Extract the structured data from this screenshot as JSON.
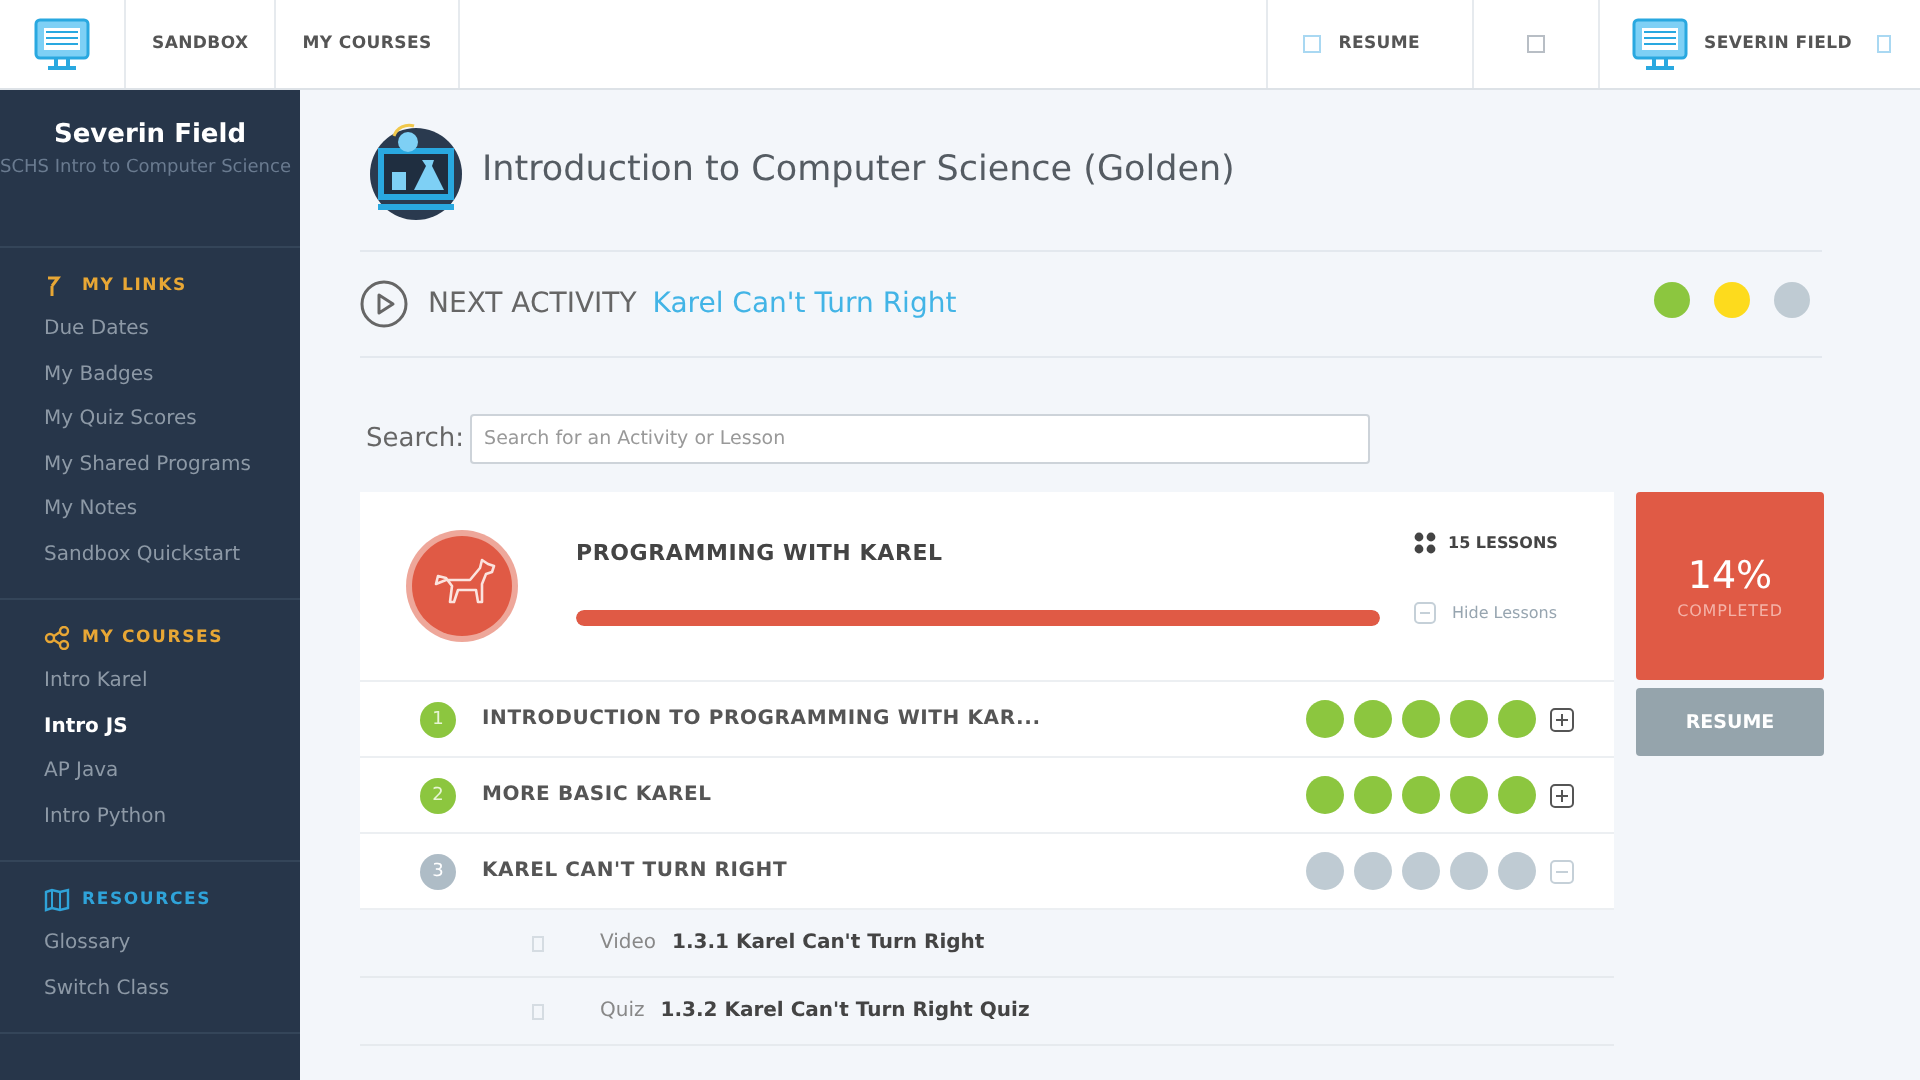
{
  "topbar": {
    "nav": [
      {
        "label": "SANDBOX",
        "selected": false
      },
      {
        "label": "MY COURSES",
        "selected": false
      }
    ],
    "resume": "RESUME",
    "user": "SEVERIN FIELD"
  },
  "sidebar": {
    "user_name": "Severin Field",
    "class_name": "SCHS Intro to Computer Science",
    "sections": [
      {
        "kind": "links",
        "title": "MY LINKS",
        "items": [
          {
            "label": "Due Dates",
            "selected": false
          },
          {
            "label": "My Badges",
            "selected": false
          },
          {
            "label": "My Quiz Scores",
            "selected": false
          },
          {
            "label": "My Shared Programs",
            "selected": false
          },
          {
            "label": "My Notes",
            "selected": false
          },
          {
            "label": "Sandbox Quickstart",
            "selected": false
          }
        ]
      },
      {
        "kind": "courses",
        "title": "MY COURSES",
        "items": [
          {
            "label": "Intro Karel",
            "selected": false
          },
          {
            "label": "Intro JS",
            "selected": true
          },
          {
            "label": "AP Java",
            "selected": false
          },
          {
            "label": "Intro Python",
            "selected": false
          }
        ]
      },
      {
        "kind": "resources",
        "title": "RESOURCES",
        "items": [
          {
            "label": "Glossary",
            "selected": false
          },
          {
            "label": "Switch Class",
            "selected": false
          }
        ]
      }
    ]
  },
  "course": {
    "title": "Introduction to Computer Science (Golden)"
  },
  "next_activity": {
    "label": "NEXT ACTIVITY",
    "link": "Karel Can't Turn Right"
  },
  "legend": [
    {
      "color": "#8cc63f"
    },
    {
      "color": "#fddb1d"
    },
    {
      "color": "#bfcbd3"
    }
  ],
  "search": {
    "label": "Search:",
    "placeholder": "Search for an Activity or Lesson"
  },
  "unit": {
    "title": "PROGRAMMING WITH KAREL",
    "lessons_count": "15 LESSONS",
    "hide_label": "Hide Lessons",
    "level": 1.0,
    "percent": "14%",
    "completed_label": "COMPLETED",
    "resume": "RESUME",
    "lessons": [
      {
        "number": "1",
        "title": "INTRODUCTION TO PROGRAMMING WITH KAR...",
        "completed": true,
        "expanded": false,
        "activities": [
          {
            "done": true
          },
          {
            "done": true
          },
          {
            "done": true
          },
          {
            "done": true
          },
          {
            "done": true
          }
        ]
      },
      {
        "number": "2",
        "title": "MORE BASIC KAREL",
        "completed": true,
        "expanded": false,
        "activities": [
          {
            "done": true
          },
          {
            "done": true
          },
          {
            "done": true
          },
          {
            "done": true
          },
          {
            "done": true
          }
        ]
      },
      {
        "number": "3",
        "title": "KAREL CAN'T TURN RIGHT",
        "completed": false,
        "expanded": true,
        "activities": [
          {
            "done": false
          },
          {
            "done": false
          },
          {
            "done": false
          },
          {
            "done": false
          },
          {
            "done": false
          }
        ],
        "items": [
          {
            "type": "Video",
            "title": "1.3.1 Karel Can't Turn Right"
          },
          {
            "type": "Quiz",
            "title": "1.3.2 Karel Can't Turn Right Quiz"
          }
        ]
      }
    ]
  }
}
